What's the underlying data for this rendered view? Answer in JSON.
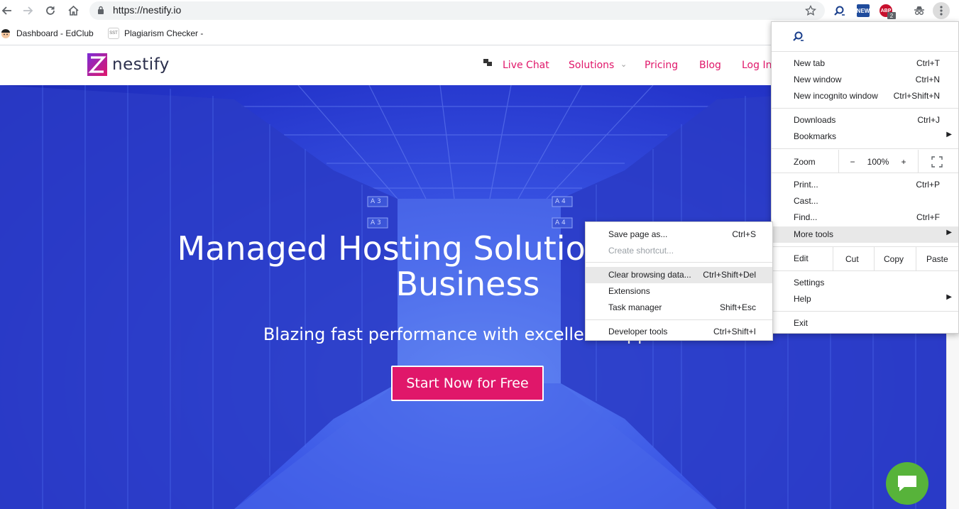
{
  "browser": {
    "url": "https://nestify.io",
    "extensions": [
      {
        "name": "find-ext",
        "badge": ""
      },
      {
        "name": "new-ext",
        "badge": "NEW"
      },
      {
        "name": "abp-ext",
        "badge": "ABP",
        "count": "2"
      }
    ]
  },
  "bookmarks": [
    {
      "label": "Dashboard - EdClub",
      "icon": "edclub-icon"
    },
    {
      "label": "Plagiarism Checker -",
      "icon": "sst-icon",
      "icon_text": "SST"
    }
  ],
  "site": {
    "logo_text": "nestify",
    "nav": {
      "live_chat": "Live Chat",
      "solutions": "Solutions",
      "pricing": "Pricing",
      "blog": "Blog",
      "login": "Log In"
    },
    "hero": {
      "title_line1": "Managed Hosting Solutions for Your",
      "title_line2": "Business",
      "subtitle": "Blazing fast performance with excellent support",
      "cta": "Start Now for Free",
      "rack_labels": [
        "A 3",
        "A 3",
        "A 4",
        "A 4"
      ]
    }
  },
  "main_menu": {
    "new_tab": {
      "label": "New tab",
      "shortcut": "Ctrl+T"
    },
    "new_window": {
      "label": "New window",
      "shortcut": "Ctrl+N"
    },
    "new_incognito": {
      "label": "New incognito window",
      "shortcut": "Ctrl+Shift+N"
    },
    "downloads": {
      "label": "Downloads",
      "shortcut": "Ctrl+J"
    },
    "bookmarks": {
      "label": "Bookmarks"
    },
    "zoom": {
      "label": "Zoom",
      "minus": "−",
      "value": "100%",
      "plus": "+"
    },
    "print": {
      "label": "Print...",
      "shortcut": "Ctrl+P"
    },
    "cast": {
      "label": "Cast..."
    },
    "find": {
      "label": "Find...",
      "shortcut": "Ctrl+F"
    },
    "more_tools": {
      "label": "More tools"
    },
    "edit": {
      "label": "Edit",
      "cut": "Cut",
      "copy": "Copy",
      "paste": "Paste"
    },
    "settings": {
      "label": "Settings"
    },
    "help": {
      "label": "Help"
    },
    "exit": {
      "label": "Exit"
    }
  },
  "more_tools_menu": {
    "save_page": {
      "label": "Save page as...",
      "shortcut": "Ctrl+S"
    },
    "create_shortcut": {
      "label": "Create shortcut..."
    },
    "clear_data": {
      "label": "Clear browsing data...",
      "shortcut": "Ctrl+Shift+Del"
    },
    "extensions": {
      "label": "Extensions"
    },
    "task_manager": {
      "label": "Task manager",
      "shortcut": "Shift+Esc"
    },
    "dev_tools": {
      "label": "Developer tools",
      "shortcut": "Ctrl+Shift+I"
    }
  },
  "colors": {
    "brand_pink": "#e0176a",
    "hero_blue": "#3047dc",
    "chat_green": "#57b33a",
    "menu_highlight": "#e8e8e8"
  }
}
